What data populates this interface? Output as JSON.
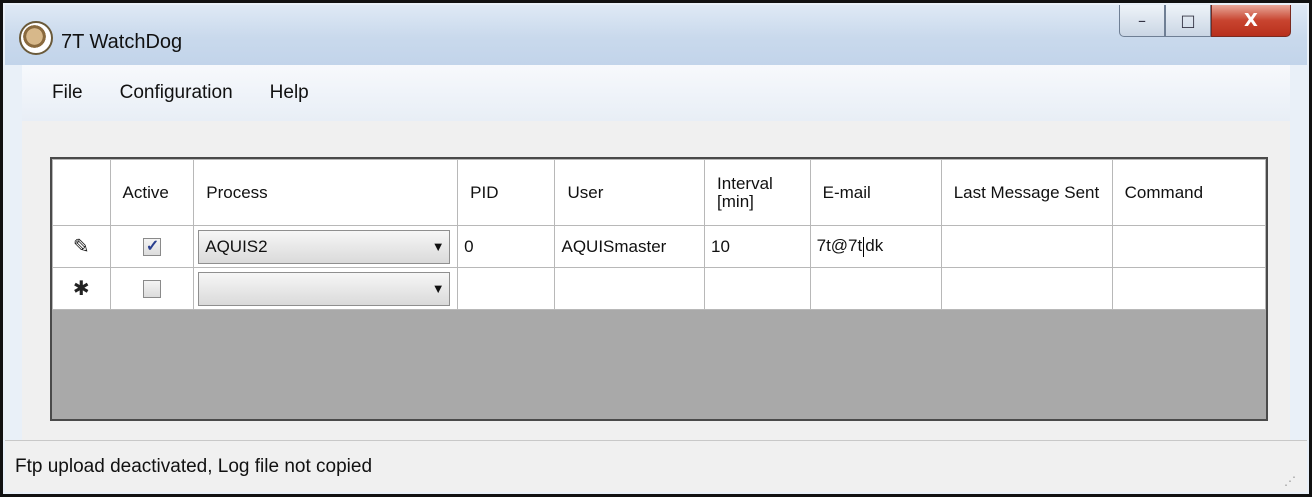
{
  "window": {
    "title": "7T WatchDog",
    "controls": {
      "minimize": "–",
      "maximize": "□",
      "close": "X"
    }
  },
  "menu": {
    "items": [
      "File",
      "Configuration",
      "Help"
    ]
  },
  "grid": {
    "columns": [
      "Active",
      "Process",
      "PID",
      "User",
      "Interval [min]",
      "E-mail",
      "Last Message Sent",
      "Command"
    ],
    "rows": [
      {
        "row_marker": "✎",
        "active": true,
        "process": "AQUIS2",
        "pid": "0",
        "user": "AQUISmaster",
        "interval": "10",
        "email_before_cursor": "7t@7t",
        "email_after_cursor": "dk",
        "last_message_sent": "",
        "command": ""
      },
      {
        "row_marker": "✱",
        "active": false,
        "process": "",
        "pid": "",
        "user": "",
        "interval": "",
        "email_before_cursor": "",
        "email_after_cursor": "",
        "last_message_sent": "",
        "command": ""
      }
    ]
  },
  "status": {
    "text": "Ftp upload deactivated, Log file not copied"
  },
  "colors": {
    "grid_background": "#a9a9a9",
    "close_button": "#c8442f"
  }
}
